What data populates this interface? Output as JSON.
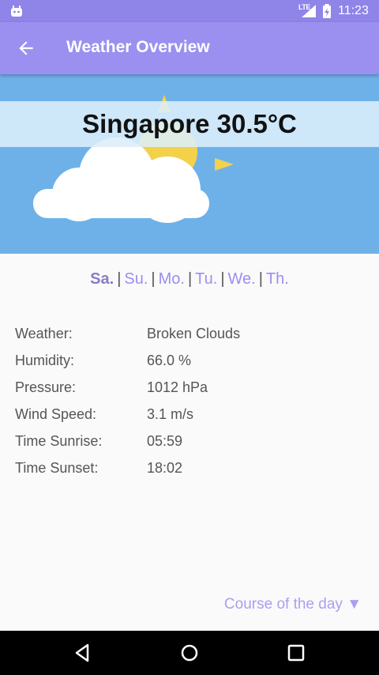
{
  "status_bar": {
    "network": "LTE",
    "time": "11:23"
  },
  "app_bar": {
    "title": "Weather Overview"
  },
  "hero": {
    "city_temp": "Singapore 30.5°C"
  },
  "days": [
    {
      "label": "Sa.",
      "selected": true
    },
    {
      "label": "Su.",
      "selected": false
    },
    {
      "label": "Mo.",
      "selected": false
    },
    {
      "label": "Tu.",
      "selected": false
    },
    {
      "label": "We.",
      "selected": false
    },
    {
      "label": "Th.",
      "selected": false
    }
  ],
  "separator": "|",
  "details": [
    {
      "label": "Weather:",
      "value": "Broken Clouds"
    },
    {
      "label": "Humidity:",
      "value": "66.0 %"
    },
    {
      "label": "Pressure:",
      "value": "1012 hPa"
    },
    {
      "label": "Wind Speed:",
      "value": "3.1 m/s"
    },
    {
      "label": "Time Sunrise:",
      "value": "05:59"
    },
    {
      "label": "Time Sunset:",
      "value": "18:02"
    }
  ],
  "course": {
    "label": "Course of the day",
    "arrow": "▼"
  },
  "colors": {
    "primary": "#9b8ff0",
    "status_bar": "#8f84e8",
    "sky": "#6eb1e8",
    "sun": "#f4d14a",
    "cloud": "#ffffff"
  },
  "icons": {
    "status_left": "android-icon",
    "signal": "signal-icon",
    "battery": "battery-icon",
    "back": "back-arrow-icon",
    "nav_back": "nav-back-icon",
    "nav_home": "nav-home-icon",
    "nav_recent": "nav-recent-icon"
  }
}
